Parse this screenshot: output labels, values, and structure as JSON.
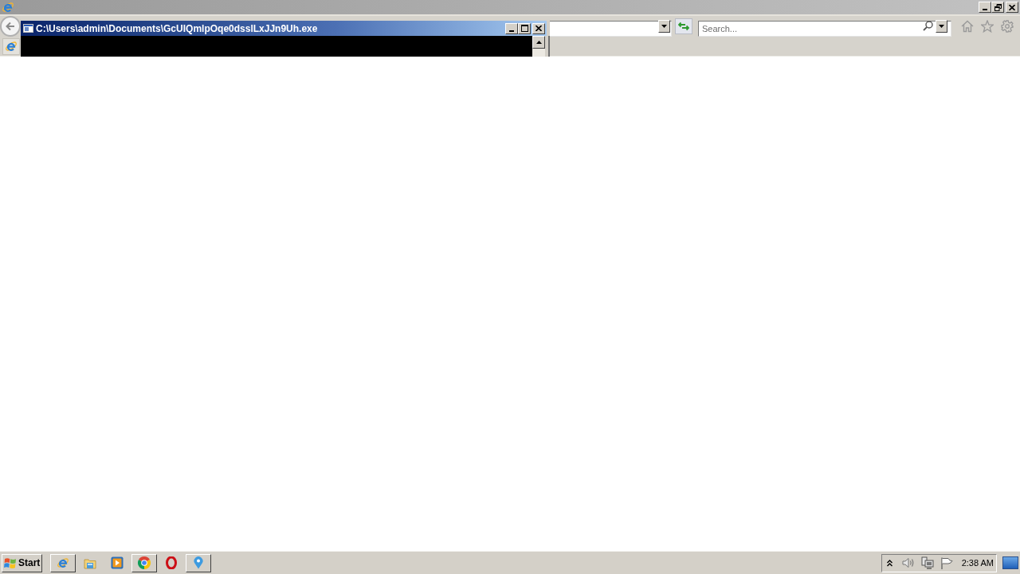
{
  "browser": {
    "search": {
      "placeholder": "Search..."
    }
  },
  "console_window": {
    "title": "C:\\Users\\admin\\Documents\\GcUIQmlpOqe0dsslLxJJn9Uh.exe"
  },
  "taskbar": {
    "start_label": "Start",
    "items": [
      {
        "kind": "browser",
        "open": true
      },
      {
        "kind": "folder",
        "open": false
      },
      {
        "kind": "player",
        "open": false
      },
      {
        "kind": "wheel",
        "open": true
      },
      {
        "kind": "oval",
        "open": false
      },
      {
        "kind": "pin",
        "open": true
      }
    ],
    "clock": "2:38 AM"
  }
}
